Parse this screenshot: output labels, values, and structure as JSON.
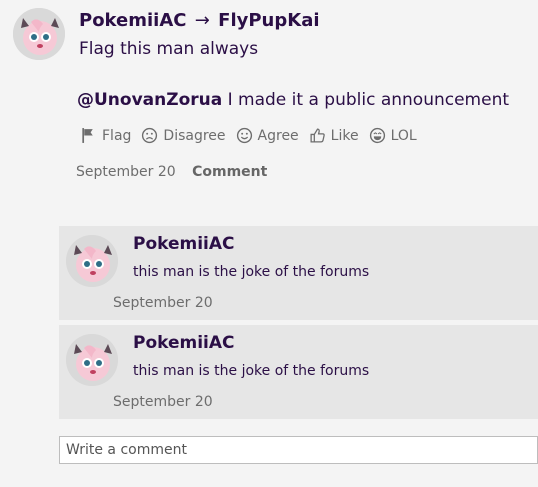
{
  "post": {
    "author": "PokemiiAC",
    "arrow": "→",
    "recipient": "FlyPupKai",
    "body_line1": "Flag this man always",
    "mention": "@UnovanZorua",
    "body_line2": " I made it a public announcement",
    "date": "September 20",
    "comment_label": "Comment"
  },
  "reactions": [
    {
      "label": "Flag",
      "icon": "flag-icon"
    },
    {
      "label": "Disagree",
      "icon": "frown-icon"
    },
    {
      "label": "Agree",
      "icon": "smile-icon"
    },
    {
      "label": "Like",
      "icon": "thumbs-up-icon"
    },
    {
      "label": "LOL",
      "icon": "laugh-icon"
    }
  ],
  "comments": [
    {
      "author": "PokemiiAC",
      "text": "this man is the joke of the forums",
      "date": "September 20"
    },
    {
      "author": "PokemiiAC",
      "text": "this man is the joke of the forums",
      "date": "September 20"
    }
  ],
  "comment_input": {
    "placeholder": "Write a comment",
    "value": ""
  },
  "colors": {
    "background": "#f4f4f4",
    "comment_bg": "#e6e6e6",
    "name_color": "#2b0f46",
    "muted": "#6d6d6d"
  }
}
